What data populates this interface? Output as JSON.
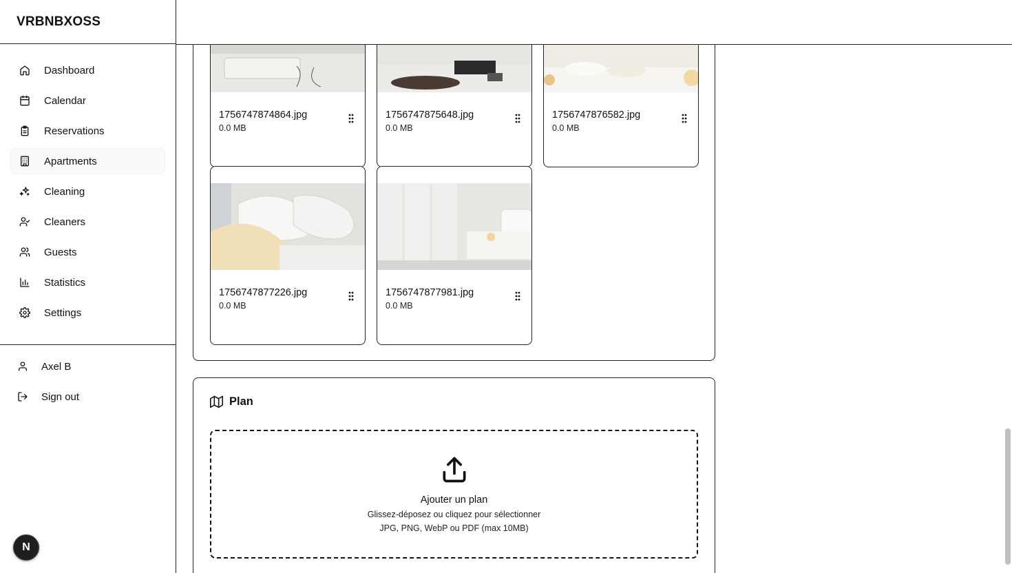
{
  "app": {
    "brand": "VRBNBXOSS"
  },
  "sidebar": {
    "items": [
      {
        "label": "Dashboard",
        "icon": "home-icon"
      },
      {
        "label": "Calendar",
        "icon": "calendar-icon"
      },
      {
        "label": "Reservations",
        "icon": "clipboard-icon"
      },
      {
        "label": "Apartments",
        "icon": "building-icon",
        "active": true
      },
      {
        "label": "Cleaning",
        "icon": "sparkles-icon"
      },
      {
        "label": "Cleaners",
        "icon": "user-check-icon"
      },
      {
        "label": "Guests",
        "icon": "users-icon"
      },
      {
        "label": "Statistics",
        "icon": "bar-chart-icon"
      },
      {
        "label": "Settings",
        "icon": "gear-icon"
      }
    ],
    "user": {
      "name": "Axel B",
      "signout": "Sign out"
    },
    "badge": "N"
  },
  "photos": [
    {
      "name": "1756747874864.jpg",
      "size": "0.0 MB"
    },
    {
      "name": "1756747875648.jpg",
      "size": "0.0 MB"
    },
    {
      "name": "1756747876582.jpg",
      "size": "0.0 MB"
    },
    {
      "name": "1756747877226.jpg",
      "size": "0.0 MB"
    },
    {
      "name": "1756747877981.jpg",
      "size": "0.0 MB"
    }
  ],
  "plan": {
    "title": "Plan",
    "upload_title": "Ajouter un plan",
    "upload_hint": "Glissez-déposez ou cliquez pour sélectionner",
    "upload_formats": "JPG, PNG, WebP ou PDF (max 10MB)"
  }
}
